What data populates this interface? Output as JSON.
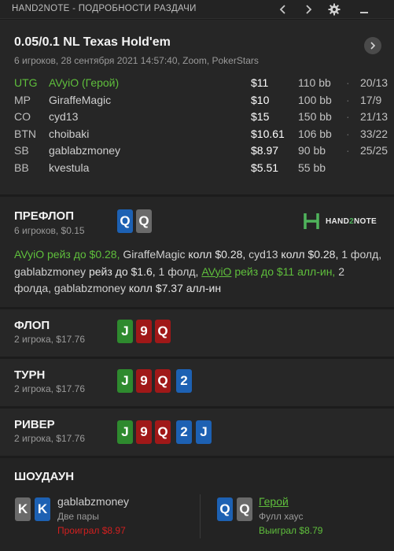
{
  "window": {
    "title": "HAND2NOTE - ПОДРОБНОСТИ РАЗДАЧИ"
  },
  "header": {
    "game": "0.05/0.1 NL Texas Hold'em",
    "details": "6 игроков, 28 сентября 2021 14:57:40, Zoom, PokerStars"
  },
  "players": [
    {
      "pos": "UTG",
      "name": "AVyiO (Герой)",
      "stack": "$11",
      "bb": "110 bb",
      "sep": "·",
      "stats": "20/13",
      "hero": true
    },
    {
      "pos": "MP",
      "name": "GiraffeMagic",
      "stack": "$10",
      "bb": "100 bb",
      "sep": "·",
      "stats": "17/9",
      "hero": false
    },
    {
      "pos": "CO",
      "name": "cyd13",
      "stack": "$15",
      "bb": "150 bb",
      "sep": "·",
      "stats": "21/13",
      "hero": false
    },
    {
      "pos": "BTN",
      "name": "choibaki",
      "stack": "$10.61",
      "bb": "106 bb",
      "sep": "·",
      "stats": "33/22",
      "hero": false
    },
    {
      "pos": "SB",
      "name": "gablabzmoney",
      "stack": "$8.97",
      "bb": "90 bb",
      "sep": "·",
      "stats": "25/25",
      "hero": false
    },
    {
      "pos": "BB",
      "name": "kvestula",
      "stack": "$5.51",
      "bb": "55 bb",
      "sep": "",
      "stats": "",
      "hero": false
    }
  ],
  "preflop": {
    "title": "ПРЕФЛОП",
    "sub": "6 игроков, $0.15",
    "cards": [
      "Q",
      "Q"
    ],
    "logo": {
      "a": "HAND",
      "b": "2",
      "c": "NOTE"
    },
    "actions": {
      "a1": "AVyiO",
      "a2": " рейз до $0.28,",
      "a3": " GiraffeMagic",
      "a4": " колл $0.28,",
      "a5": " cyd13",
      "a6": " колл $0.28,",
      "a7": " 1 фолд,",
      "a8": " gablabzmoney",
      "a9": " рейз до $1.6,",
      "a10": " 1 фолд,",
      "a11": "AVyiO",
      "a12": " рейз до $11 алл-ин,",
      "a13": " 2 фолда,",
      "a14": " gablabzmoney",
      "a15": " колл $7.37 алл-ин"
    }
  },
  "flop": {
    "title": "ФЛОП",
    "sub": "2 игрока, $17.76",
    "cards": [
      "J",
      "9",
      "Q"
    ]
  },
  "turn": {
    "title": "ТУРН",
    "sub": "2 игрока, $17.76",
    "cards": [
      "J",
      "9",
      "Q",
      "2"
    ]
  },
  "river": {
    "title": "РИВЕР",
    "sub": "2 игрока, $17.76",
    "cards": [
      "J",
      "9",
      "Q",
      "2",
      "J"
    ]
  },
  "showdown": {
    "title": "ШОУДАУН",
    "p1": {
      "cards": [
        "K",
        "K"
      ],
      "name": "gablabzmoney",
      "hand": "Две пары",
      "result": "Проиграл $8.97"
    },
    "p2": {
      "cards": [
        "Q",
        "Q"
      ],
      "name": "Герой",
      "hand": "Фулл хаус",
      "result": "Выиграл $8.79"
    }
  },
  "colors": {
    "win": "#5fbf3c",
    "lose": "#d21f1f",
    "club": "#2e8a2e",
    "heart": "#a01818",
    "diamond": "#1d61b3",
    "spade": "#6a6a6a"
  },
  "icons": [
    "back-arrow-icon",
    "forward-arrow-icon",
    "gear-icon",
    "minimize-icon",
    "next-hand-icon"
  ]
}
